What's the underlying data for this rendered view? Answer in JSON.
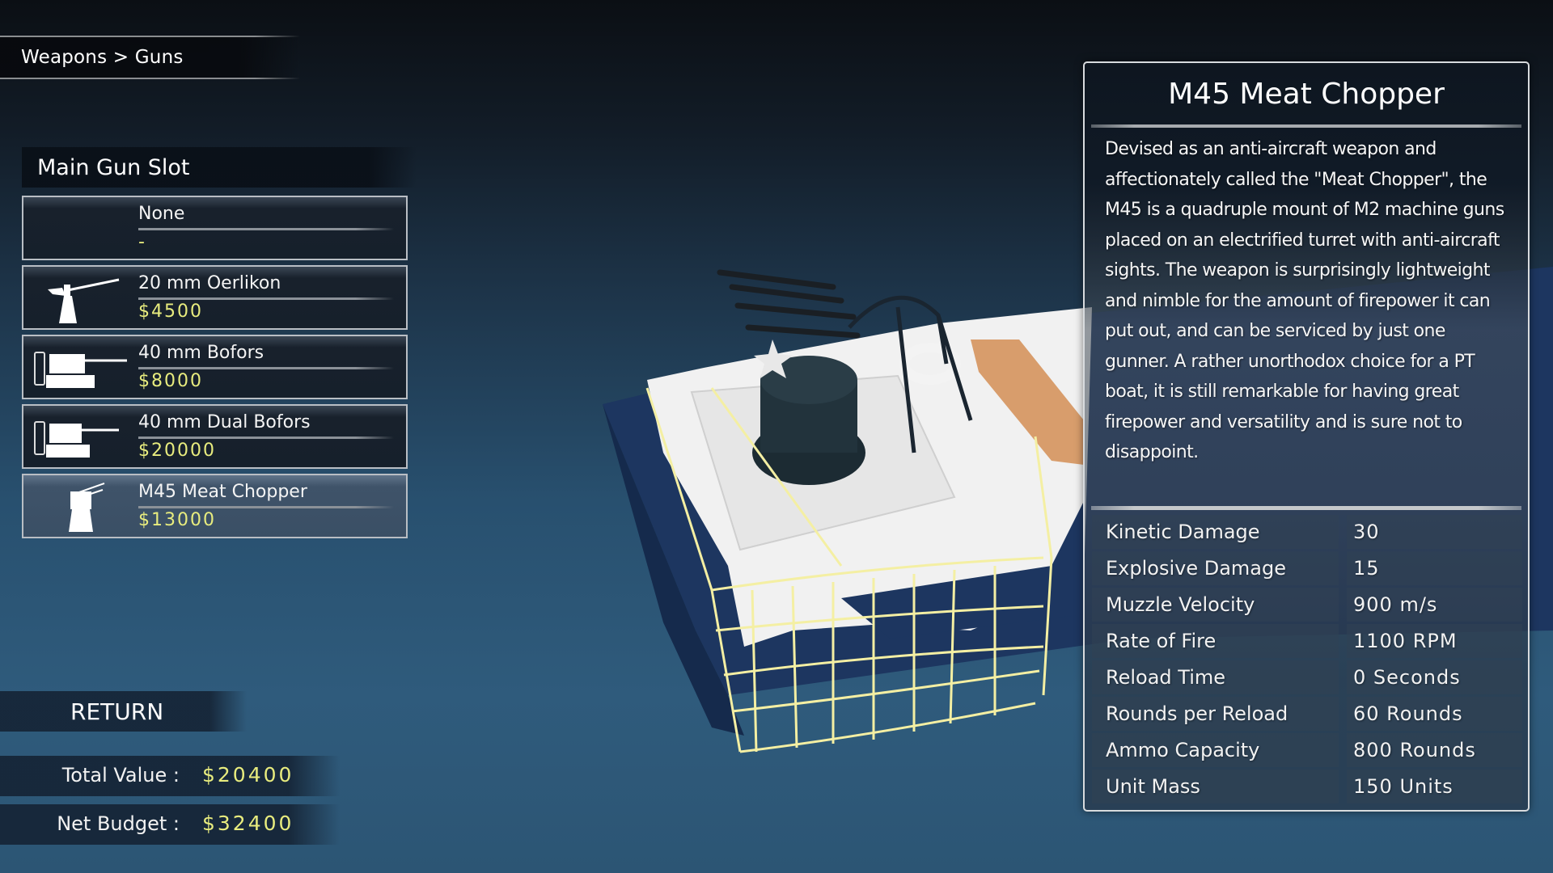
{
  "breadcrumb": "Weapons > Guns",
  "slot": {
    "title": "Main Gun Slot",
    "items": [
      {
        "name": "None",
        "price": "-",
        "icon": "none",
        "selected": false
      },
      {
        "name": "20 mm Oerlikon",
        "price": "$4500",
        "icon": "oerlikon-gun-icon",
        "selected": false
      },
      {
        "name": "40 mm Bofors",
        "price": "$8000",
        "icon": "bofors-gun-icon",
        "selected": false
      },
      {
        "name": "40 mm Dual Bofors",
        "price": "$20000",
        "icon": "dual-bofors-gun-icon",
        "selected": false
      },
      {
        "name": "M45 Meat Chopper",
        "price": "$13000",
        "icon": "m45-quad-gun-icon",
        "selected": true
      }
    ]
  },
  "footer": {
    "return_label": "RETURN",
    "total_value_label": "Total Value :",
    "total_value": "$20400",
    "net_budget_label": "Net Budget :",
    "net_budget": "$32400"
  },
  "detail": {
    "title": "M45 Meat Chopper",
    "description": "Devised as an anti-aircraft weapon and affectionately called the \"Meat Chopper\", the M45 is a quadruple mount of M2 machine guns placed on an electrified turret with anti-aircraft sights. The weapon is surprisingly lightweight and nimble for the amount of firepower it can put out, and can be serviced by just one gunner. A rather unorthodox choice for a PT boat, it is still remarkable for having great firepower and versatility and is sure not to disappoint.",
    "stats": [
      {
        "label": "Kinetic Damage",
        "value": "30"
      },
      {
        "label": "Explosive Damage",
        "value": "15"
      },
      {
        "label": "Muzzle Velocity",
        "value": "900 m/s"
      },
      {
        "label": "Rate of Fire",
        "value": "1100 RPM"
      },
      {
        "label": "Reload Time",
        "value": "0 Seconds"
      },
      {
        "label": "Rounds per Reload",
        "value": "60 Rounds"
      },
      {
        "label": "Ammo Capacity",
        "value": "800 Rounds"
      },
      {
        "label": "Unit Mass",
        "value": "150 Units"
      }
    ]
  },
  "colors": {
    "price": "#e8ec7e",
    "selected_row": "#3f5369",
    "panel_border": "#d8dbde"
  }
}
